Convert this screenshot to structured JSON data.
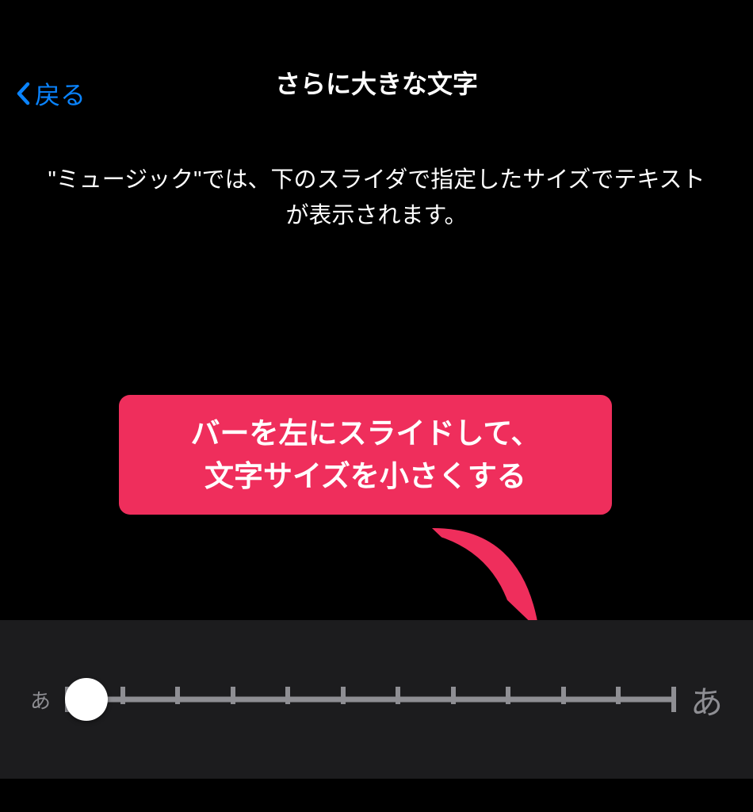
{
  "header": {
    "back_label": "戻る",
    "title": "さらに大きな文字"
  },
  "body": {
    "description": "\"ミュージック\"では、下のスライダで指定したサイズでテキストが表示されます。"
  },
  "callout": {
    "line1": "バーを左にスライドして、",
    "line2": "文字サイズを小さくする"
  },
  "slider": {
    "small_label": "あ",
    "large_label": "あ",
    "tick_count": 12,
    "thumb_position_percent": 3.5
  },
  "colors": {
    "accent_blue": "#0a84ff",
    "callout_pink": "#ef2e5c",
    "panel_bg": "#1c1c1e",
    "track_gray": "#8e8e93"
  }
}
